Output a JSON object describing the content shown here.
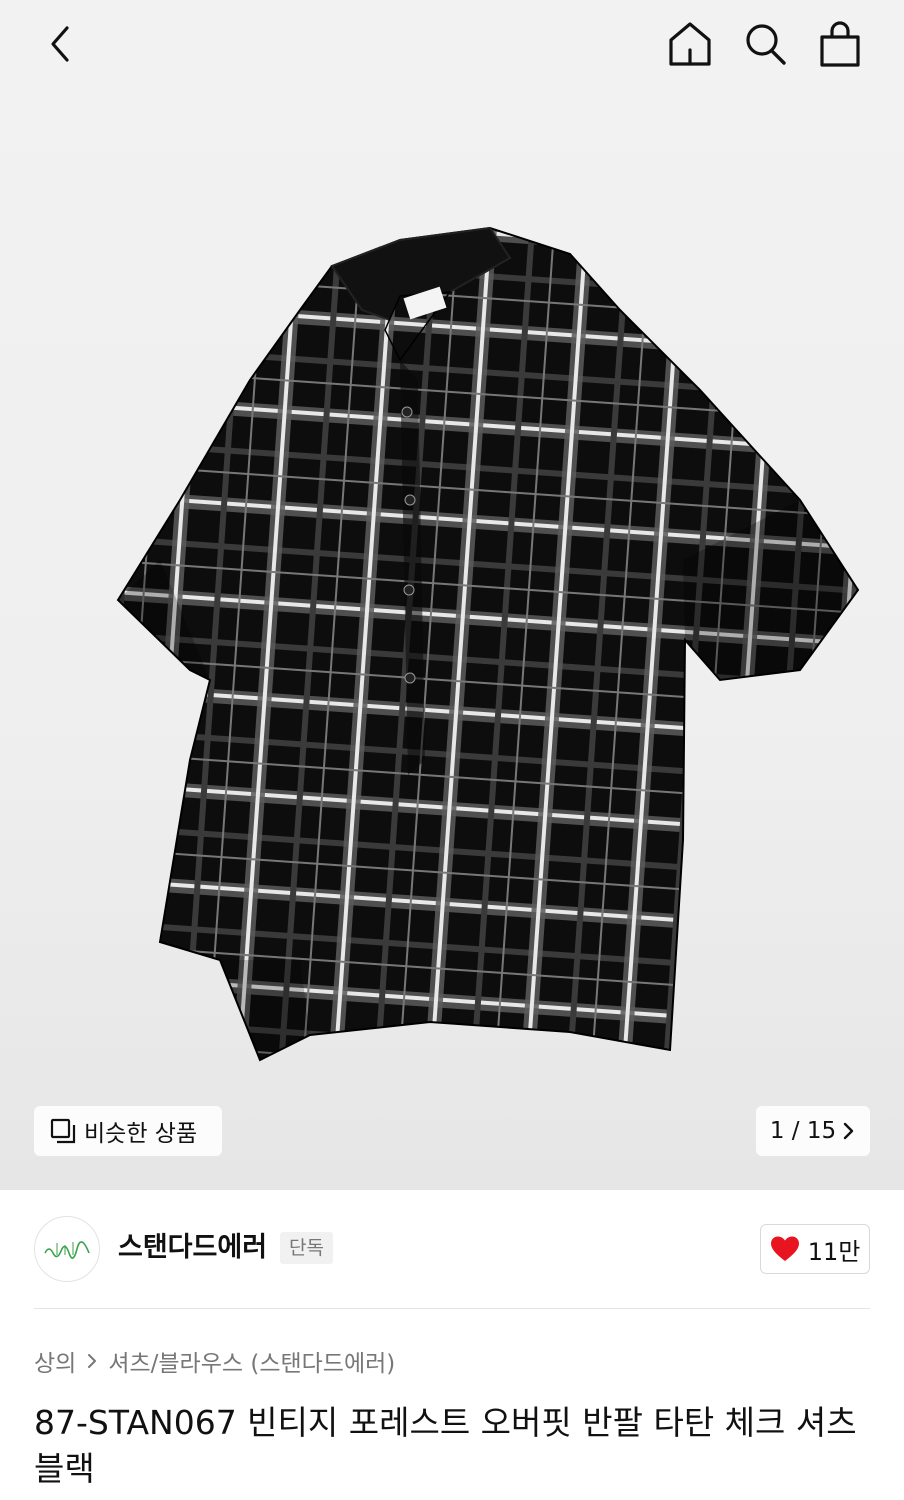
{
  "header": {
    "back_icon": "chevron-left-icon",
    "home_icon": "home-icon",
    "search_icon": "search-icon",
    "bag_icon": "shopping-bag-icon"
  },
  "gallery": {
    "similar_label": "비슷한 상품",
    "similar_icon": "similar-items-icon",
    "counter": "1 / 15",
    "counter_icon": "chevron-right-icon"
  },
  "brand": {
    "name": "스탠다드에러",
    "badge": "단독",
    "likes": "11만",
    "like_color": "#e8141f"
  },
  "breadcrumb": {
    "items": [
      "상의",
      "셔츠/블라우스 (스탠다드에러)"
    ]
  },
  "product": {
    "title": "87-STAN067 빈티지 포레스트 오버핏 반팔 타탄 체크 셔츠 블랙"
  }
}
